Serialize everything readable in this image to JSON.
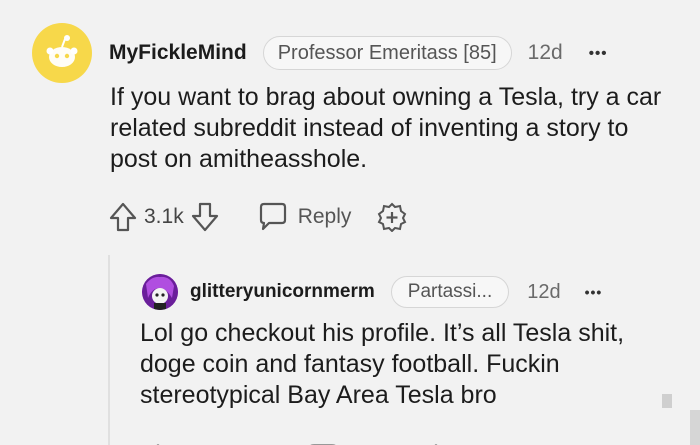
{
  "comments": [
    {
      "username": "MyFickleMind",
      "flair": "Professor Emeritass [85]",
      "time": "12d",
      "more": "•••",
      "body": "If you want to brag about owning a Tesla, try a car related subreddit instead of inventing a story to post on amitheasshole.",
      "votes": "3.1k",
      "reply_label": "Reply",
      "avatar_color": "#f7d84a"
    },
    {
      "username": "glitteryunicornmerm",
      "flair": "Partassi...",
      "time": "12d",
      "more": "•••",
      "body": "Lol go checkout his profile. It’s all Tesla shit, doge coin and fantasy football. Fuckin stereotypical Bay Area Tesla bro",
      "avatar_color": "#8a2fb8"
    }
  ],
  "icons": [
    "snoo-avatar-icon",
    "upvote-icon",
    "downvote-icon",
    "reply-bubble-icon",
    "award-plus-icon",
    "more-options-icon"
  ]
}
